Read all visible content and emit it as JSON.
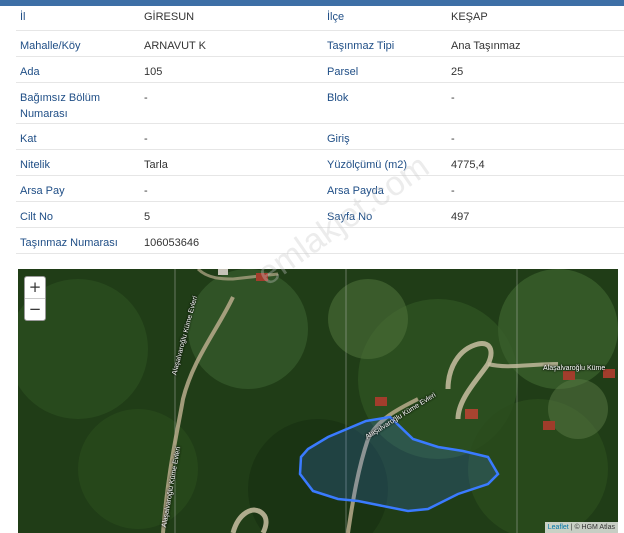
{
  "info_rows": [
    {
      "l1": "İl",
      "v1": "GİRESUN",
      "l2": "İlçe",
      "v2": "KEŞAP"
    },
    {
      "l1": "Mahalle/Köy",
      "v1": "ARNAVUT K",
      "l2": "Taşınmaz Tipi",
      "v2": "Ana Taşınmaz"
    },
    {
      "l1": "Ada",
      "v1": "105",
      "l2": "Parsel",
      "v2": "25"
    },
    {
      "l1": "Bağımsız Bölüm Numarası",
      "v1": "-",
      "l2": "Blok",
      "v2": "-"
    },
    {
      "l1": "Kat",
      "v1": "-",
      "l2": "Giriş",
      "v2": "-"
    },
    {
      "l1": "Nitelik",
      "v1": "Tarla",
      "l2": "Yüzölçümü (m2)",
      "v2": "4775,4"
    },
    {
      "l1": "Arsa Pay",
      "v1": "-",
      "l2": "Arsa Payda",
      "v2": "-"
    },
    {
      "l1": "Cilt No",
      "v1": "5",
      "l2": "Sayfa No",
      "v2": "497"
    },
    {
      "l1": "Taşınmaz Numarası",
      "v1": "106053646",
      "l2": "",
      "v2": ""
    }
  ],
  "map": {
    "zoom_in": "+",
    "zoom_out": "−",
    "attribution_leaflet": "Leaflet",
    "attribution_rest": " | © HGM Atlas",
    "road_labels": [
      "Alaşalvaroğlu Küme Evleri",
      "Alaşalvaroğlu Küme Evleri",
      "Alaşalvaroğlu Küme",
      "Alaşalvaroğlu Küme Evleri"
    ],
    "parcel_color": "#3a7bff"
  },
  "watermark": "emlakjet.com"
}
